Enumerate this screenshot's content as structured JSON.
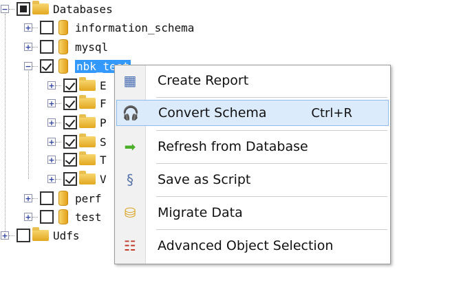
{
  "tree": {
    "root": {
      "label": "Databases"
    },
    "databases": [
      {
        "label": "information_schema",
        "checked": false
      },
      {
        "label": "mysql",
        "checked": false
      },
      {
        "label": "nbk_test",
        "checked": true,
        "selected": true
      },
      {
        "label": "perf",
        "checked": false
      },
      {
        "label": "test",
        "checked": false
      }
    ],
    "children": [
      "E",
      "F",
      "P",
      "S",
      "T",
      "V"
    ],
    "udfs": {
      "label": "Udfs"
    }
  },
  "menu": {
    "items": [
      {
        "label": "Create Report",
        "icon": "report-icon"
      },
      {
        "label": "Convert Schema",
        "shortcut": "Ctrl+R",
        "icon": "headphones-icon",
        "highlighted": true
      },
      {
        "label": "Refresh from Database",
        "icon": "green-arrow-icon"
      },
      {
        "label": "Save as Script",
        "icon": "scroll-icon"
      },
      {
        "label": "Migrate Data",
        "icon": "migrate-icon"
      },
      {
        "label": "Advanced Object Selection",
        "icon": "checklist-icon"
      }
    ]
  }
}
